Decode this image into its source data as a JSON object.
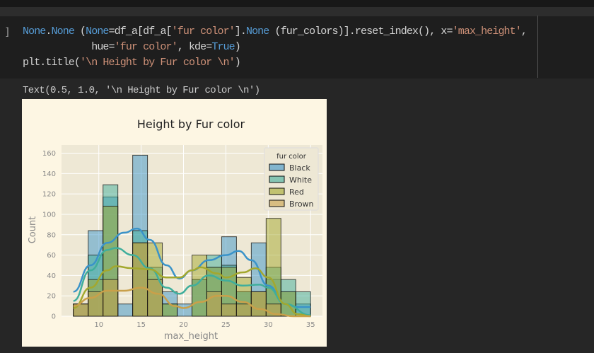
{
  "cell": {
    "prompt": "]",
    "code": {
      "l1_a": "None",
      "l1_dot": ".",
      "l1_b": "None",
      "l1_c": " (",
      "l1_d": "None",
      "l1_e": "=df_a[df_a[",
      "l1_f": "'fur color'",
      "l1_g": "].",
      "l1_h": "None",
      "l1_i": " (fur_colors)].reset_index(), x=",
      "l1_j": "'max_height'",
      "l1_k": ",",
      "l2_a": "            hue=",
      "l2_b": "'fur color'",
      "l2_c": ", kde=",
      "l2_d": "True",
      "l2_e": ")",
      "l3_a": "plt.title(",
      "l3_b": "'\\n Height by Fur color \\n'",
      "l3_c": ")"
    },
    "output_text": "Text(0.5, 1.0, '\\n Height by Fur color \\n')"
  },
  "chart_data": {
    "type": "bar",
    "title": "Height by Fur color",
    "xlabel": "max_height",
    "ylabel": "Count",
    "xlim": [
      5.6,
      36.4
    ],
    "ylim": [
      0,
      168
    ],
    "xticks": [
      "10",
      "15",
      "20",
      "25",
      "30",
      "35"
    ],
    "yticks": [
      "0",
      "20",
      "40",
      "60",
      "80",
      "100",
      "120",
      "140",
      "160"
    ],
    "bin_edges": [
      7,
      8.75,
      10.5,
      12.25,
      14,
      15.75,
      17.5,
      19.25,
      21,
      22.75,
      24.5,
      26.25,
      28,
      29.75,
      31.5,
      33.25,
      35
    ],
    "legend_title": "fur color",
    "legend_position": "top-right",
    "grid": true,
    "series": [
      {
        "name": "Black",
        "color": "#3a93c9",
        "values": [
          12,
          84,
          117,
          12,
          158,
          36,
          24,
          12,
          36,
          48,
          78,
          24,
          72,
          36,
          24,
          12
        ],
        "kde_x": [
          7,
          9,
          11,
          13,
          14.5,
          16,
          18,
          19.5,
          21,
          23,
          25,
          26.5,
          28,
          30,
          32,
          33.5,
          35
        ],
        "kde_y": [
          24,
          50,
          72,
          82,
          86,
          75,
          50,
          37,
          45,
          55,
          60,
          64,
          55,
          30,
          12,
          9,
          9
        ]
      },
      {
        "name": "White",
        "color": "#3fae9c",
        "values": [
          0,
          60,
          129,
          0,
          84,
          48,
          12,
          0,
          36,
          60,
          50,
          24,
          24,
          48,
          36,
          24
        ],
        "kde_x": [
          7,
          9,
          11,
          12,
          14,
          16,
          18,
          19.5,
          21,
          23,
          25,
          27,
          29,
          30,
          32,
          35
        ],
        "kde_y": [
          15,
          45,
          65,
          67,
          60,
          47,
          28,
          22,
          30,
          40,
          35,
          30,
          31,
          28,
          12,
          1
        ]
      },
      {
        "name": "Red",
        "color": "#a3a82e",
        "values": [
          12,
          36,
          108,
          0,
          72,
          72,
          12,
          0,
          60,
          48,
          48,
          38,
          24,
          96,
          24,
          0
        ],
        "kde_x": [
          7,
          9,
          11,
          12,
          14,
          16,
          18,
          19.5,
          21,
          22,
          24,
          25,
          27,
          28.5,
          30,
          32,
          33.5,
          35
        ],
        "kde_y": [
          8,
          28,
          45,
          49,
          47,
          46,
          38,
          38,
          45,
          48,
          42,
          38,
          43,
          47,
          38,
          12,
          2,
          0
        ]
      },
      {
        "name": "Brown",
        "color": "#c9a04a",
        "values": [
          12,
          24,
          36,
          0,
          72,
          36,
          0,
          0,
          0,
          24,
          12,
          12,
          24,
          12,
          0,
          0
        ],
        "kde_x": [
          7,
          9,
          11,
          13,
          15,
          17,
          19,
          20,
          22,
          24,
          25,
          27,
          29,
          31,
          33,
          35
        ],
        "kde_y": [
          10,
          18,
          25,
          25,
          28,
          22,
          10,
          8,
          14,
          20,
          20,
          14,
          7,
          2,
          0,
          0
        ]
      }
    ]
  }
}
